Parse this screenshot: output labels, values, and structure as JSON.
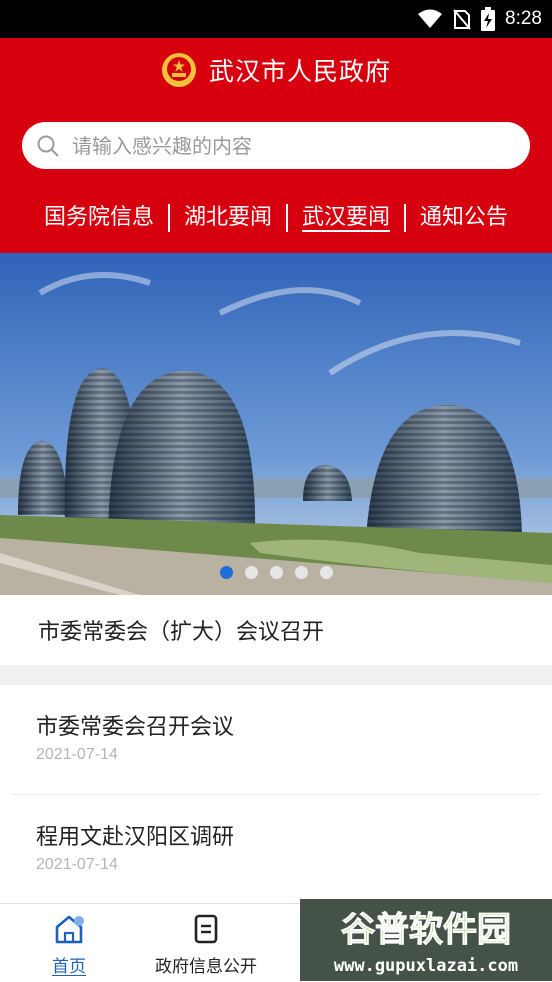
{
  "status_bar": {
    "time": "8:28"
  },
  "header": {
    "app_title": "武汉市人民政府",
    "search_placeholder": "请输入感兴趣的内容",
    "tabs": [
      {
        "label": "国务院信息",
        "active": false
      },
      {
        "label": "湖北要闻",
        "active": false
      },
      {
        "label": "武汉要闻",
        "active": true
      },
      {
        "label": "通知公告",
        "active": false
      }
    ]
  },
  "banner": {
    "caption": "市委常委会（扩大）会议召开",
    "slide_count": 5,
    "active_slide": 1
  },
  "news": [
    {
      "title": "市委常委会召开会议",
      "date": "2021-07-14"
    },
    {
      "title": "程用文赴汉阳区调研",
      "date": "2021-07-14"
    }
  ],
  "bottom_nav": {
    "items": [
      {
        "label": "首页",
        "icon": "home-icon",
        "active": true
      },
      {
        "label": "政府信息公开",
        "icon": "document-icon",
        "active": false
      }
    ]
  },
  "watermark": {
    "brand": "谷普软件园",
    "url": "www.gupuxlazai.com"
  },
  "colors": {
    "header_red": "#d7000f",
    "accent_blue": "#1f5fbf",
    "indicator_blue": "#1f6fd6"
  }
}
